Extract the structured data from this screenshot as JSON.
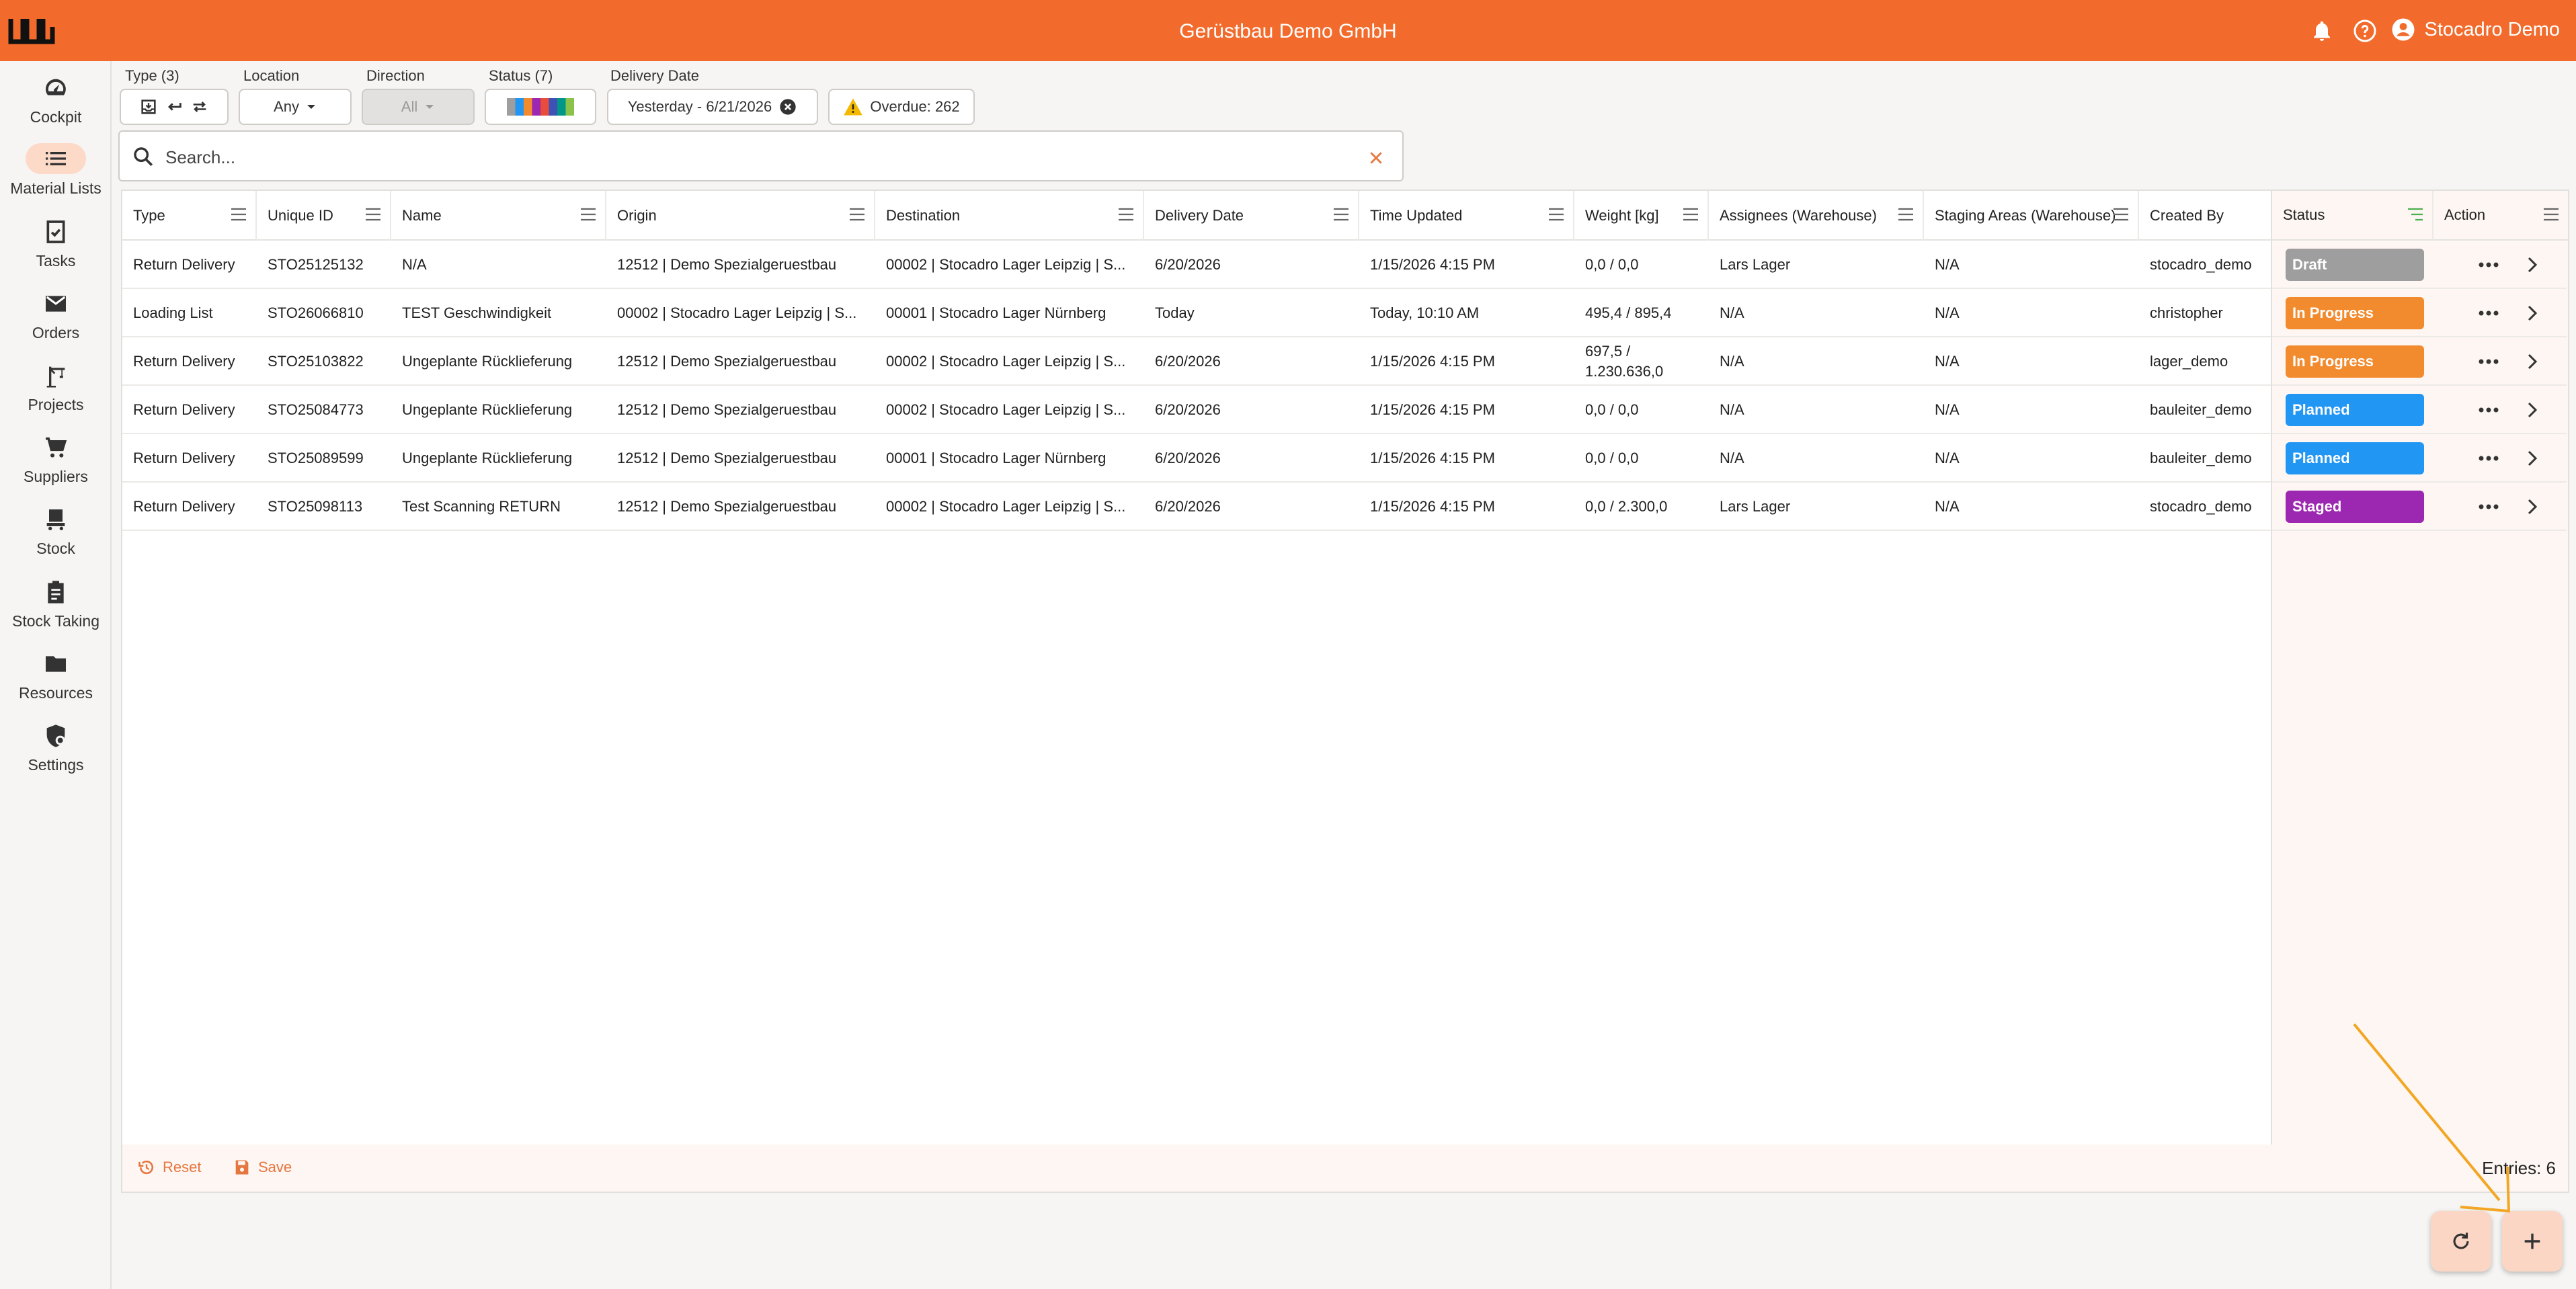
{
  "header": {
    "title": "Gerüstbau Demo GmbH",
    "user_name": "Stocadro Demo"
  },
  "sidebar": {
    "items": [
      {
        "label": "Cockpit",
        "icon": "gauge-icon"
      },
      {
        "label": "Material Lists",
        "icon": "list-icon",
        "active": true
      },
      {
        "label": "Tasks",
        "icon": "clipboard-check-icon"
      },
      {
        "label": "Orders",
        "icon": "mail-icon"
      },
      {
        "label": "Projects",
        "icon": "crane-icon"
      },
      {
        "label": "Suppliers",
        "icon": "cart-icon"
      },
      {
        "label": "Stock",
        "icon": "forklift-icon"
      },
      {
        "label": "Stock Taking",
        "icon": "clipboard-list-icon"
      },
      {
        "label": "Resources",
        "icon": "folder-icon"
      },
      {
        "label": "Settings",
        "icon": "shield-gear-icon"
      }
    ]
  },
  "filters": {
    "type_label": "Type (3)",
    "location_label": "Location",
    "location_value": "Any",
    "direction_label": "Direction",
    "direction_value": "All",
    "status_label": "Status (7)",
    "status_colors": [
      "#9e9e9e",
      "#2196f3",
      "#f28a2e",
      "#9c27b0",
      "#e94b3c",
      "#3f51b5",
      "#009688",
      "#8bc34a"
    ],
    "delivery_date_label": "Delivery Date",
    "delivery_date_value": "Yesterday - 6/21/2026",
    "overdue_label": "Overdue: 262"
  },
  "search": {
    "placeholder": "Search..."
  },
  "table": {
    "columns": [
      "Type",
      "Unique ID",
      "Name",
      "Origin",
      "Destination",
      "Delivery Date",
      "Time Updated",
      "Weight [kg]",
      "Assignees (Warehouse)",
      "Staging Areas (Warehouse)",
      "Created By",
      "Status",
      "Action"
    ],
    "rows": [
      {
        "type": "Return Delivery",
        "id": "STO25125132",
        "name": "N/A",
        "origin": "12512 | Demo Spezialgeruestbau",
        "destination": "00002 | Stocadro Lager Leipzig | S...",
        "delivery": "6/20/2026",
        "updated": "1/15/2026 4:15 PM",
        "weight": "0,0 / 0,0",
        "assignees": "Lars Lager",
        "staging": "N/A",
        "created_by": "stocadro_demo",
        "status": "Draft",
        "status_color": "#9e9e9e"
      },
      {
        "type": "Loading List",
        "id": "STO26066810",
        "name": "TEST Geschwindigkeit",
        "origin": "00002 | Stocadro Lager Leipzig | S...",
        "destination": "00001 | Stocadro Lager Nürnberg",
        "delivery": "Today",
        "updated": "Today, 10:10 AM",
        "weight": "495,4 / 895,4",
        "assignees": "N/A",
        "staging": "N/A",
        "created_by": "christopher",
        "status": "In Progress",
        "status_color": "#f28a2e"
      },
      {
        "type": "Return Delivery",
        "id": "STO25103822",
        "name": "Ungeplante Rücklieferung",
        "origin": "12512 | Demo Spezialgeruestbau",
        "destination": "00002 | Stocadro Lager Leipzig | S...",
        "delivery": "6/20/2026",
        "updated": "1/15/2026 4:15 PM",
        "weight": "697,5 / 1.230.636,0",
        "assignees": "N/A",
        "staging": "N/A",
        "created_by": "lager_demo",
        "status": "In Progress",
        "status_color": "#f28a2e"
      },
      {
        "type": "Return Delivery",
        "id": "STO25084773",
        "name": "Ungeplante Rücklieferung",
        "origin": "12512 | Demo Spezialgeruestbau",
        "destination": "00002 | Stocadro Lager Leipzig | S...",
        "delivery": "6/20/2026",
        "updated": "1/15/2026 4:15 PM",
        "weight": "0,0 / 0,0",
        "assignees": "N/A",
        "staging": "N/A",
        "created_by": "bauleiter_demo",
        "status": "Planned",
        "status_color": "#2196f3"
      },
      {
        "type": "Return Delivery",
        "id": "STO25089599",
        "name": "Ungeplante Rücklieferung",
        "origin": "12512 | Demo Spezialgeruestbau",
        "destination": "00001 | Stocadro Lager Nürnberg",
        "delivery": "6/20/2026",
        "updated": "1/15/2026 4:15 PM",
        "weight": "0,0 / 0,0",
        "assignees": "N/A",
        "staging": "N/A",
        "created_by": "bauleiter_demo",
        "status": "Planned",
        "status_color": "#2196f3"
      },
      {
        "type": "Return Delivery",
        "id": "STO25098113",
        "name": "Test Scanning RETURN",
        "origin": "12512 | Demo Spezialgeruestbau",
        "destination": "00002 | Stocadro Lager Leipzig | S...",
        "delivery": "6/20/2026",
        "updated": "1/15/2026 4:15 PM",
        "weight": "0,0 / 2.300,0",
        "assignees": "Lars Lager",
        "staging": "N/A",
        "created_by": "stocadro_demo",
        "status": "Staged",
        "status_color": "#9c27b0"
      }
    ]
  },
  "footer": {
    "reset_label": "Reset",
    "save_label": "Save",
    "entries_label": "Entries: 6"
  },
  "colors": {
    "brand": "#f26b2c",
    "accent_soft": "#fbd6c4",
    "annotation": "#f2a623"
  }
}
